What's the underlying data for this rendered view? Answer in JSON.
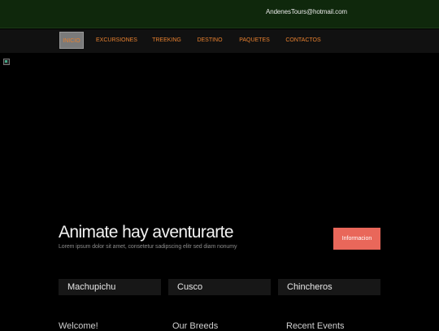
{
  "header": {
    "email": "AndenesTours@hotmail.com"
  },
  "nav": {
    "items": [
      "INICIO",
      "EXCURSIONES",
      "TREEKING",
      "DESTINO",
      "PAQUETES",
      "CONTACTOS"
    ]
  },
  "hero": {
    "title": "Animate hay aventurarte",
    "subtitle": "Lorem ipsum dolor sit amet, consetetur sadipscing elitr sed diam nonumy",
    "button_label": "Informacion"
  },
  "cards": [
    "Machupichu",
    "Cusco",
    "Chincheros"
  ],
  "sections": [
    "Welcome!",
    "Our Breeds",
    "Recent Events"
  ],
  "colors": {
    "topbar": "#0f280c",
    "accent": "#e9675a",
    "nav_text": "#e8812f"
  }
}
